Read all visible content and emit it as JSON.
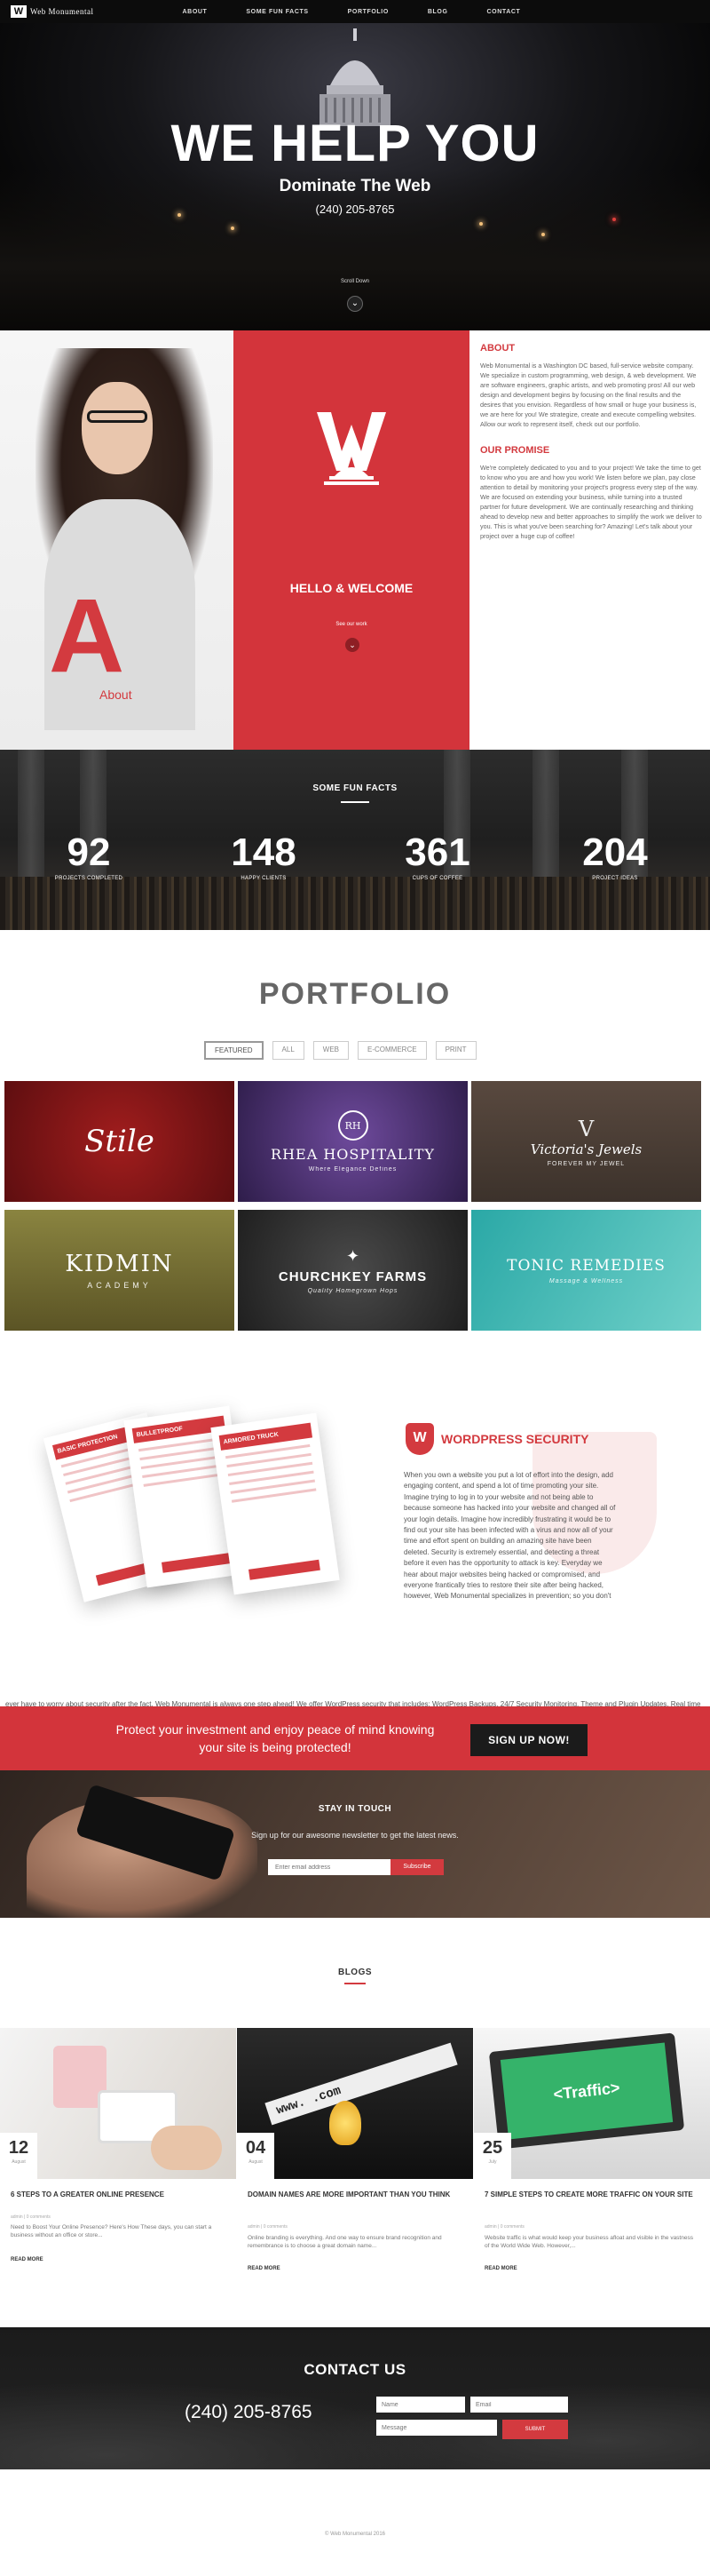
{
  "nav": {
    "brand": "Web Monumental",
    "brand_mark": "W",
    "items": [
      "ABOUT",
      "SOME FUN FACTS",
      "PORTFOLIO",
      "BLOG",
      "CONTACT"
    ]
  },
  "hero": {
    "title": "WE HELP YOU",
    "subtitle": "Dominate The Web",
    "phone": "(240) 205-8765",
    "scroll_label": "Scroll Down",
    "scroll_icon": "chevron-down-icon"
  },
  "welcome": {
    "title": "HELLO & WELCOME",
    "see_work": "See our work"
  },
  "about": {
    "big_letter": "A",
    "label": "About",
    "heading": "ABOUT",
    "text": "Web Monumental is a Washington DC based, full-service website company. We specialize in custom programming, web design, & web development. We are software engineers, graphic artists, and web promoting pros! All our web design and development begins by focusing on the final results and the desires that you envision. Regardless of how small or huge your business is, we are here for you! We strategize, create and execute compelling websites. Allow our work to represent itself, check out our portfolio.",
    "promise_heading": "OUR PROMISE",
    "promise_text": "We're completely dedicated to you and to your project! We take the time to get to know who you are and how you work! We listen before we plan, pay close attention to detail by monitoring your project's progress every step of the way. We are focused on extending your business, while turning into a trusted partner for future development. We are continually researching and thinking ahead to develop new and better approaches to simplify the work we deliver to you. This is what you've been searching for? Amazing! Let's talk about your project over a huge cup of coffee!"
  },
  "facts": {
    "heading": "SOME FUN FACTS",
    "items": [
      {
        "value": "92",
        "label": "PROJECTS COMPLETED"
      },
      {
        "value": "148",
        "label": "HAPPY CLIENTS"
      },
      {
        "value": "361",
        "label": "CUPS OF COFFEE"
      },
      {
        "value": "204",
        "label": "PROJECT IDEAS"
      }
    ]
  },
  "portfolio": {
    "heading": "PORTFOLIO",
    "filters": [
      "FEATURED",
      "ALL",
      "WEB",
      "E-COMMERCE",
      "PRINT"
    ],
    "items": [
      {
        "title": "Stile",
        "sub": ""
      },
      {
        "title": "RHEA HOSPITALITY",
        "sub": "Where Elegance Defines"
      },
      {
        "title": "Victoria's Jewels",
        "sub": "FOREVER MY JEWEL"
      },
      {
        "title": "KIDMIN",
        "sub": "ACADEMY"
      },
      {
        "title": "CHURCHKEY FARMS",
        "sub": "Quality Homegrown Hops"
      },
      {
        "title": "TONIC REMEDIES",
        "sub": "Massage & Wellness"
      }
    ]
  },
  "security": {
    "title": "WORDPRESS SECURITY",
    "logo_mark": "W",
    "cards": [
      "BASIC PROTECTION",
      "BULLETPROOF",
      "ARMORED TRUCK"
    ],
    "text": "When you own a website you put a lot of effort into the design, add engaging content, and spend a lot of time promoting your site. Imagine trying to log in to your website and not being able to because someone has hacked into your website and changed all of your login details. Imagine how incredibly frustrating it would be to find out your site has been infected with a virus and now all of your time and effort spent on building an amazing site have been deleted. Security is extremely essential, and detecting a threat before it even has the opportunity to attack is key. Everyday we hear about major websites being hacked or compromised, and everyone frantically tries to restore their site after being hacked, however, Web Monumental specializes in prevention; so you don't",
    "text2": "ever have to worry about security after the fact. Web Monumental is always one step ahead! We offer WordPress security that includes: WordPress Backups, 24/7 Security Monitoring, Theme and Plugin Updates, Real time Activity Tracking and more! Take action and secure your website, sign up now!"
  },
  "cta": {
    "text": "Protect your investment and enjoy peace of mind knowing your site is being protected!",
    "button": "SIGN UP NOW!"
  },
  "newsletter": {
    "heading": "STAY IN TOUCH",
    "subtitle": "Sign up for our awesome newsletter to get the latest news.",
    "placeholder": "Enter email address",
    "button": "Subscribe"
  },
  "blogs": {
    "heading": "BLOGS",
    "items": [
      {
        "day": "12",
        "month": "August",
        "title": "6 STEPS TO A GREATER ONLINE PRESENCE",
        "meta": "admin  |  0 comments",
        "excerpt": "Need to Boost Your Online Presence? Here's How These days, you can start a business without an office or store...",
        "more": "READ MORE"
      },
      {
        "day": "04",
        "month": "August",
        "title": "DOMAIN NAMES ARE MORE IMPORTANT THAN YOU THINK",
        "meta": "admin  |  0 comments",
        "excerpt": "Online branding is everything. And one way to ensure brand recognition and remembrance is to choose a great domain name...",
        "more": "READ MORE"
      },
      {
        "day": "25",
        "month": "July",
        "title": "7 SIMPLE STEPS TO CREATE MORE TRAFFIC ON YOUR SITE",
        "meta": "admin  |  0 comments",
        "excerpt": "Website traffic is what would keep your business afloat and visible in the vastness of the World Wide Web. However,...",
        "more": "READ MORE"
      }
    ]
  },
  "contact": {
    "heading": "CONTACT US",
    "phone": "(240) 205-8765",
    "name_placeholder": "Name",
    "email_placeholder": "Email",
    "message_placeholder": "Message",
    "button": "SUBMIT"
  },
  "footer": {
    "text": "© Web Monumental 2016"
  },
  "colors": {
    "accent": "#d3343b",
    "nav_bg": "#0c0c0c",
    "dark": "#1b1b1b"
  }
}
